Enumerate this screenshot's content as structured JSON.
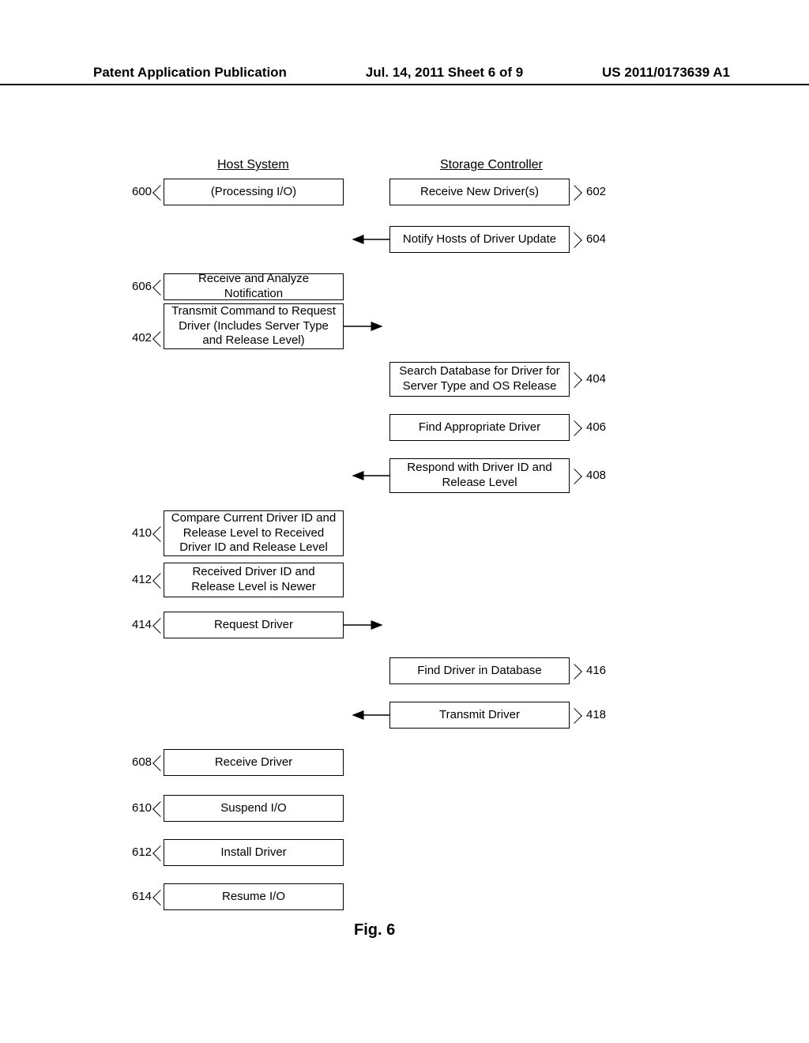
{
  "header": {
    "left": "Patent Application Publication",
    "center": "Jul. 14, 2011   Sheet 6 of 9",
    "right": "US 2011/0173639 A1"
  },
  "columns": {
    "host": "Host System",
    "storage": "Storage Controller"
  },
  "boxes": {
    "b600": "(Processing I/O)",
    "b602": "Receive New Driver(s)",
    "b604": "Notify Hosts of Driver Update",
    "b606": "Receive and Analyze Notification",
    "b402": "Transmit Command to Request Driver (Includes Server Type and Release Level)",
    "b404": "Search Database for Driver for Server Type and OS Release",
    "b406": "Find Appropriate Driver",
    "b408": "Respond with Driver ID and Release Level",
    "b410": "Compare Current Driver ID and Release Level to Received Driver ID and Release Level",
    "b412": "Received Driver ID and Release Level is Newer",
    "b414": "Request Driver",
    "b416": "Find Driver in Database",
    "b418": "Transmit Driver",
    "b608": "Receive Driver",
    "b610": "Suspend I/O",
    "b612": "Install Driver",
    "b614": "Resume I/O"
  },
  "refs": {
    "r600": "600",
    "r602": "602",
    "r604": "604",
    "r606": "606",
    "r402": "402",
    "r404": "404",
    "r406": "406",
    "r408": "408",
    "r410": "410",
    "r412": "412",
    "r414": "414",
    "r416": "416",
    "r418": "418",
    "r608": "608",
    "r610": "610",
    "r612": "612",
    "r614": "614"
  },
  "figure_caption": "Fig. 6"
}
